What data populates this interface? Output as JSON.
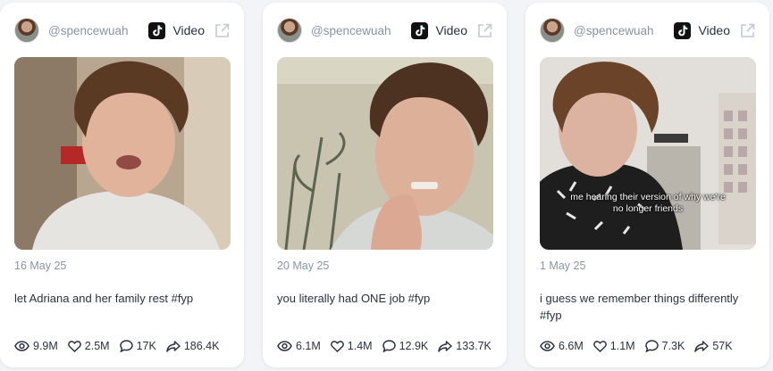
{
  "cards": [
    {
      "handle": "@spencewuah",
      "platform_icon": "tiktok-icon",
      "type_label": "Video",
      "date": "16 May 25",
      "caption": "let Adriana and her family rest #fyp",
      "overlay_text": "",
      "stats": {
        "views": "9.9M",
        "likes": "2.5M",
        "comments": "17K",
        "shares": "186.4K"
      }
    },
    {
      "handle": "@spencewuah",
      "platform_icon": "tiktok-icon",
      "type_label": "Video",
      "date": "20 May 25",
      "caption": "you literally had ONE job #fyp",
      "overlay_text": "",
      "stats": {
        "views": "6.1M",
        "likes": "1.4M",
        "comments": "12.9K",
        "shares": "133.7K"
      }
    },
    {
      "handle": "@spencewuah",
      "platform_icon": "tiktok-icon",
      "type_label": "Video",
      "date": "1 May 25",
      "caption": "i guess we remember things differently #fyp",
      "overlay_text": "me hearing their version of why we're no longer friends",
      "stats": {
        "views": "6.6M",
        "likes": "1.1M",
        "comments": "7.3K",
        "shares": "57K"
      }
    }
  ],
  "colors": {
    "accent_text": "#2b3140",
    "muted_text": "#8a93a6",
    "card_bg": "#ffffff",
    "page_bg": "#f3f4f7"
  }
}
